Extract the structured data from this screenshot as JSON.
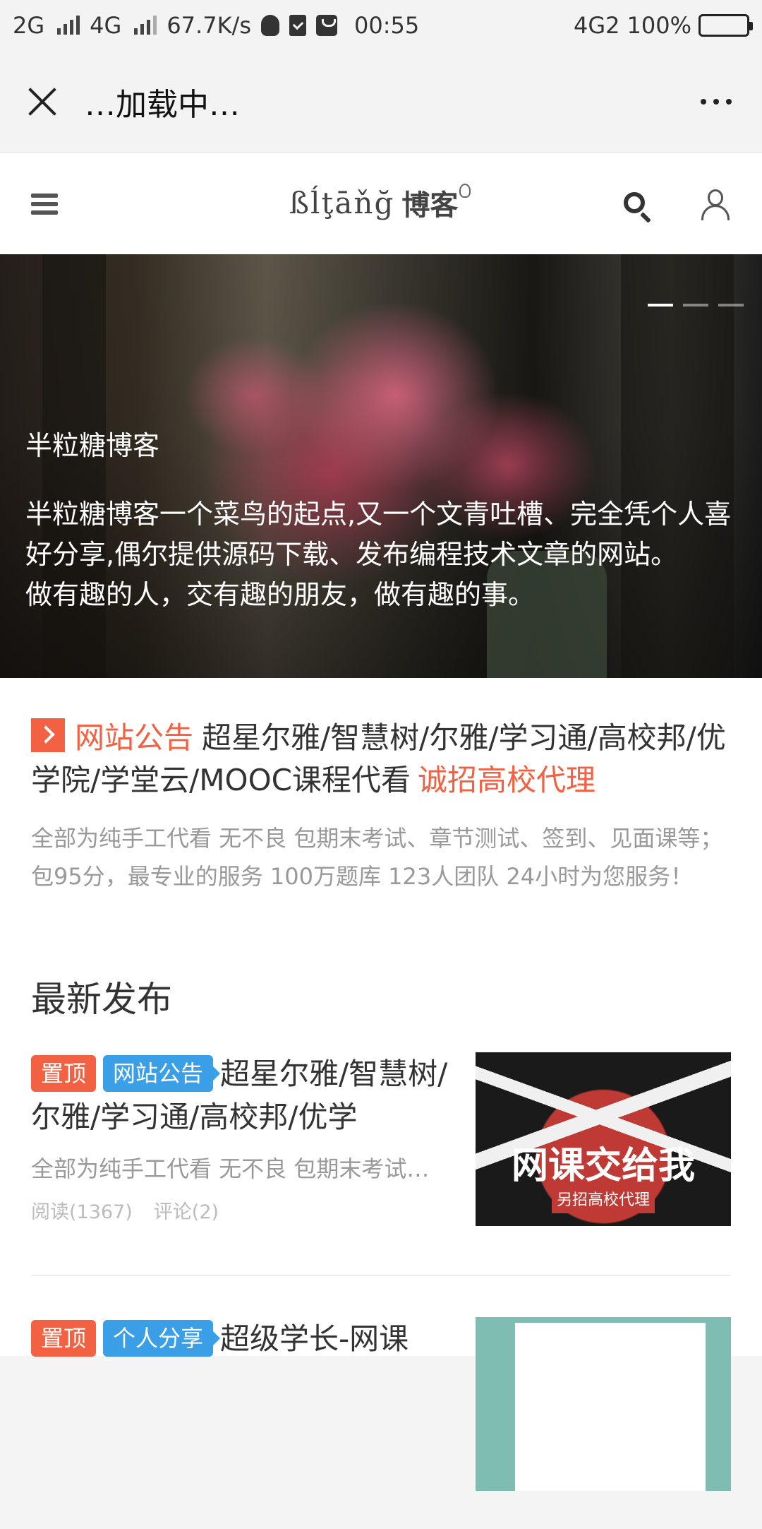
{
  "status": {
    "net1": "2G",
    "net2": "4G",
    "speed": "67.7K/s",
    "time": "00:55",
    "net3": "4G2",
    "battery": "100%"
  },
  "nav": {
    "title": "…加载中…"
  },
  "header": {
    "logo_latin": "ßĺţāňğ",
    "logo_cjk": "博客"
  },
  "hero": {
    "title": "半粒糖博客",
    "desc": "半粒糖博客一个菜鸟的起点,又一个文青吐槽、完全凭个人喜好分享,偶尔提供源码下载、发布编程技术文章的网站。",
    "desc2": "做有趣的人，交有趣的朋友，做有趣的事。"
  },
  "notice": {
    "tag": "网站公告",
    "text": "超星尔雅/智慧树/尔雅/学习通/高校邦/优学院/学堂云/MOOC课程代看",
    "highlight": "诚招高校代理",
    "sub": "全部为纯手工代看 无不良 包期末考试、章节测试、签到、见面课等；包95分，最专业的服务 100万题库 123人团队 24小时为您服务！"
  },
  "section_title": "最新发布",
  "posts": [
    {
      "tag_top": "置顶",
      "tag_cat": "网站公告",
      "title": "超星尔雅/智慧树/尔雅/学习通/高校邦/优学",
      "excerpt": "全部为纯手工代看 无不良 包期末考试…",
      "reads": "阅读(1367)",
      "comments": "评论(2)",
      "thumb_main": "网课交给我",
      "thumb_sub": "另招高校代理"
    },
    {
      "tag_top": "置顶",
      "tag_cat": "个人分享",
      "title": "超级学长-网课"
    }
  ]
}
